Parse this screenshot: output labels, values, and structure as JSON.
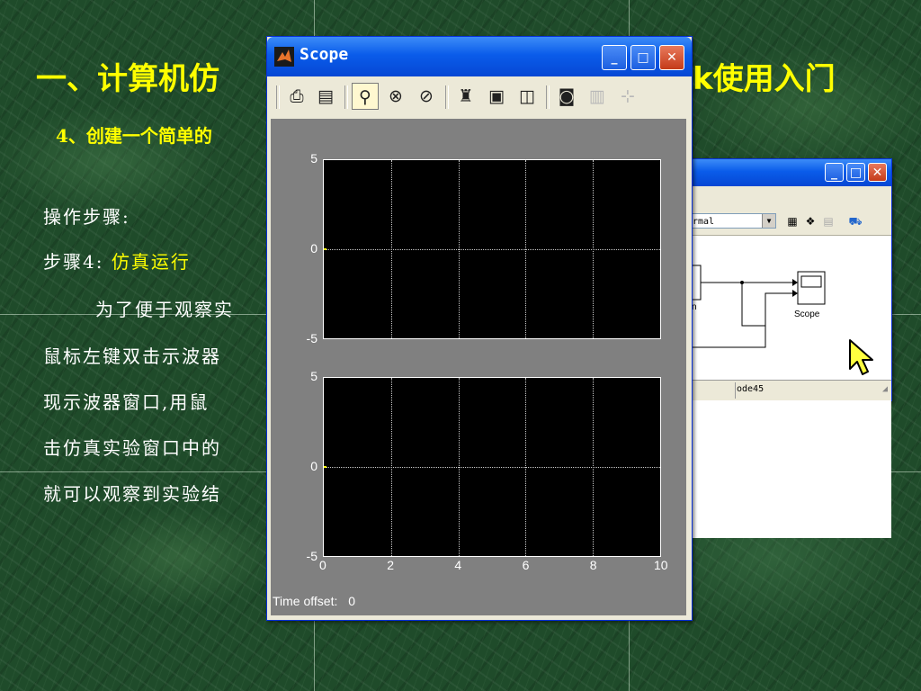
{
  "slide": {
    "title_left": "一、计算机仿",
    "title_right": "k使用入门",
    "subtitle": "4、创建一个简单的",
    "steps_label": "操作步骤:",
    "step4_prefix": "步骤4:",
    "step4_action": "仿真运行",
    "para_lines": [
      "为了便于观察实",
      "鼠标左键双击示波器",
      "现示波器窗口,用鼠",
      "击仿真实验窗口中的",
      "就可以观察到实验结"
    ]
  },
  "simulink_window": {
    "solver_combo_value": "rmal",
    "status_solver": "ode45",
    "scope_block_label": "Scope",
    "partial_block_label": "n"
  },
  "scope_window": {
    "title": "Scope",
    "time_offset_label": "Time offset:",
    "time_offset_value": "0",
    "toolbar_icons": [
      "print-icon",
      "parameters-icon",
      "zoom-icon",
      "zoom-x-icon",
      "zoom-y-icon",
      "autoscale-icon",
      "save-axes-icon",
      "restore-axes-icon",
      "floating-scope-icon",
      "lock-axes-icon",
      "signal-selector-icon"
    ]
  },
  "chart_data": {
    "type": "line",
    "subplots": [
      {
        "ylim": [
          -5,
          5
        ],
        "yticks": [
          "5",
          "0",
          "-5"
        ],
        "xlim": [
          0,
          10
        ],
        "grid": true,
        "series": []
      },
      {
        "ylim": [
          -5,
          5
        ],
        "yticks": [
          "5",
          "0",
          "-5"
        ],
        "xlim": [
          0,
          10
        ],
        "xticks": [
          "0",
          "2",
          "4",
          "6",
          "8",
          "10"
        ],
        "grid": true,
        "series": []
      }
    ],
    "colors": {
      "axes_bg": "#000000",
      "figure_bg": "#808080",
      "grid": "#c8c8c8",
      "zero_marker": "#ffff00"
    }
  }
}
